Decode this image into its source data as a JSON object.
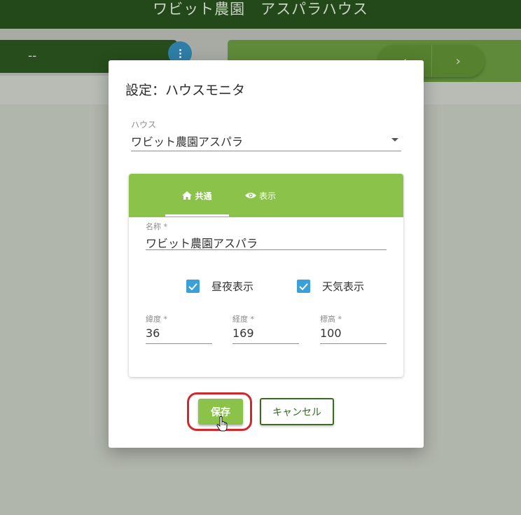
{
  "app": {
    "title": "ワビット農園　アスパラハウス",
    "status_value": "--",
    "nav_prev": "‹",
    "nav_next": "›"
  },
  "dialog": {
    "title": "設定：ハウスモニタ",
    "house": {
      "label": "ハウス",
      "value": "ワビット農園アスパラ"
    },
    "tabs": [
      {
        "label": "共通",
        "icon": "home-icon",
        "active": true
      },
      {
        "label": "表示",
        "icon": "eye-icon",
        "active": false
      }
    ],
    "name_field": {
      "label": "名称 *",
      "value": "ワビット農園アスパラ"
    },
    "checkboxes": [
      {
        "label": "昼夜表示",
        "checked": true
      },
      {
        "label": "天気表示",
        "checked": true
      }
    ],
    "latitude": {
      "label": "緯度 *",
      "value": "36"
    },
    "longitude": {
      "label": "経度 *",
      "value": "169"
    },
    "altitude": {
      "label": "標高 *",
      "value": "100"
    },
    "save_label": "保存",
    "cancel_label": "キャンセル"
  },
  "colors": {
    "header": "#23491a",
    "accent_green": "#8bc34a",
    "checkbox_blue": "#3aa1d8",
    "highlight_red": "#d3272e"
  }
}
